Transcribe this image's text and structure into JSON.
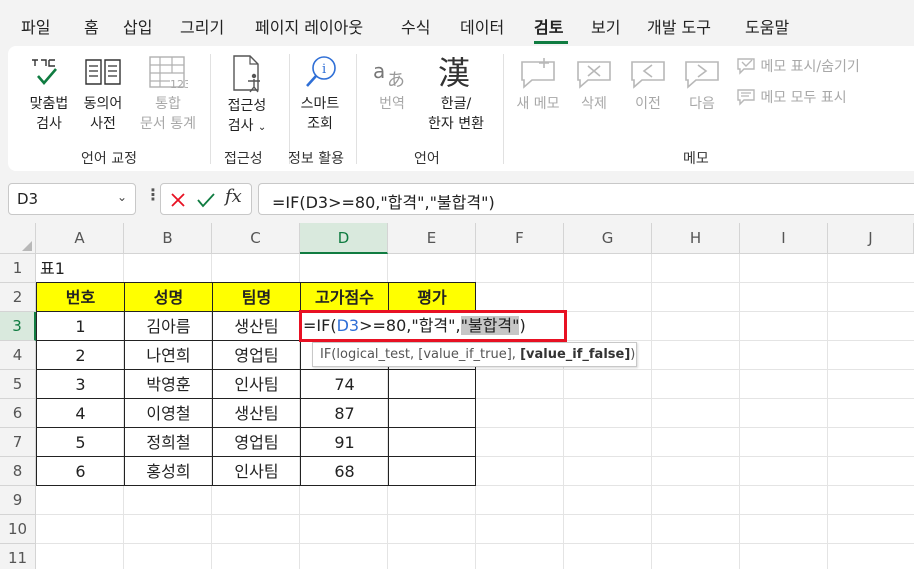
{
  "menu": {
    "tabs": [
      "파일",
      "홈",
      "삽입",
      "그리기",
      "페이지 레이아웃",
      "수식",
      "데이터",
      "검토",
      "보기",
      "개발 도구",
      "도움말"
    ],
    "active": "검토"
  },
  "ribbon": {
    "spell_line1": "맞춤법",
    "spell_line2": "검사",
    "thesaurus_line1": "동의어",
    "thesaurus_line2": "사전",
    "stats_line1": "통합",
    "stats_line2": "문서 통계",
    "group_proofing": "언어 교정",
    "access_line1": "접근성",
    "access_line2": "검사",
    "group_access": "접근성",
    "smart_line1": "스마트",
    "smart_line2": "조회",
    "group_insights": "정보 활용",
    "translate_label": "번역",
    "hanja_line1": "한글/",
    "hanja_line2": "한자 변환",
    "group_language": "언어",
    "new_memo": "새 메모",
    "delete_memo": "삭제",
    "prev_memo": "이전",
    "next_memo": "다음",
    "show_hide_memo": "메모 표시/숨기기",
    "show_all_memo": "메모 모두 표시",
    "group_memo": "메모"
  },
  "formula_bar": {
    "name_box": "D3",
    "fx": "fx",
    "formula": "=IF(D3>=80,\"합격\",\"불합격\")"
  },
  "grid": {
    "columns": [
      "A",
      "B",
      "C",
      "D",
      "E",
      "F",
      "G",
      "H",
      "I",
      "J"
    ],
    "rows": [
      "1",
      "2",
      "3",
      "4",
      "5",
      "6",
      "7",
      "8",
      "9",
      "10",
      "11"
    ],
    "table_title": "표1",
    "headers": [
      "번호",
      "성명",
      "팀명",
      "고가점수",
      "평가"
    ],
    "data": [
      [
        "1",
        "김아름",
        "생산팀",
        "",
        ""
      ],
      [
        "2",
        "나연희",
        "영업팀",
        "",
        ""
      ],
      [
        "3",
        "박영훈",
        "인사팀",
        "74",
        ""
      ],
      [
        "4",
        "이영철",
        "생산팀",
        "87",
        ""
      ],
      [
        "5",
        "정희철",
        "영업팀",
        "91",
        ""
      ],
      [
        "6",
        "홍성희",
        "인사팀",
        "68",
        ""
      ]
    ]
  },
  "edit": {
    "p1": "=IF(",
    "ref": "D3",
    "p2": ">=80,\"합격\",",
    "hl": "\"불합격\"",
    "p3": ")"
  },
  "tooltip": {
    "p1": "IF(logical_test, [value_if_true], ",
    "bold": "[value_if_false]",
    "p2": ")"
  }
}
